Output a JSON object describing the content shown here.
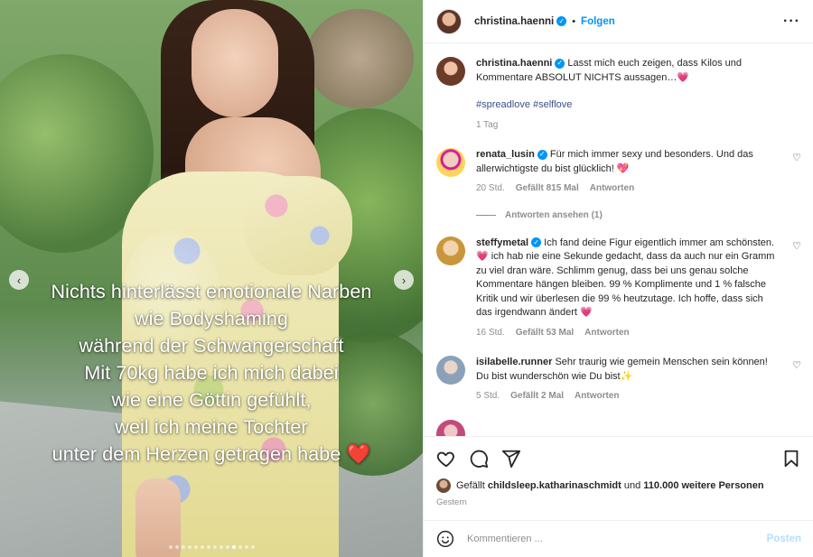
{
  "media": {
    "overlay_lines": [
      "Nichts hinterlässt emotionale Narben",
      "wie Bodyshaming",
      "während der Schwangerschaft",
      "Mit 70kg habe ich mich dabei",
      "wie eine Göttin gefühlt,",
      "weil ich meine Tochter",
      "unter dem Herzen getragen habe"
    ],
    "overlay_heart": "❤️",
    "prev_arrow": "‹",
    "next_arrow": "›",
    "dots_total": 14,
    "dots_active_index": 10
  },
  "header": {
    "username": "christina.haenni",
    "separator": "•",
    "follow_label": "Folgen",
    "more_icon": "···"
  },
  "caption": {
    "username": "christina.haenni",
    "text": "Lasst mich euch zeigen, dass Kilos und Kommentare ABSOLUT NICHTS aussagen…💗",
    "hashtags": "#spreadlove #selflove",
    "time": "1 Tag"
  },
  "comments": [
    {
      "username": "renata_lusin",
      "verified": true,
      "text": "Für mich immer sexy und besonders. Und das allerwichtigste du bist glücklich! 💖",
      "time": "20 Std.",
      "likes": "Gefällt 815 Mal",
      "reply": "Antworten"
    },
    {
      "username": "steffymetal",
      "verified": true,
      "text": "Ich fand deine Figur eigentlich immer am schönsten. 💗 ich hab nie eine Sekunde gedacht, dass da auch nur ein Gramm zu viel dran wäre. Schlimm genug, dass bei uns genau solche Kommentare hängen bleiben. 99 % Komplimente und 1 % falsche Kritik und wir überlesen die 99 % heutzutage. Ich hoffe, dass sich das irgendwann ändert 💗",
      "time": "16 Std.",
      "likes": "Gefällt 53 Mal",
      "reply": "Antworten"
    },
    {
      "username": "isilabelle.runner",
      "verified": false,
      "text": "Sehr traurig wie gemein Menschen sein können! Du bist wunderschön wie Du bist✨",
      "time": "5 Std.",
      "likes": "Gefällt 2 Mal",
      "reply": "Antworten"
    }
  ],
  "view_replies": "Antworten ansehen (1)",
  "actions": {
    "likes_prefix": "Gefällt",
    "likes_user": "childsleep.katharinaschmidt",
    "likes_middle": "und",
    "likes_count": "110.000 weitere Personen",
    "date": "Gestern"
  },
  "comment_box": {
    "placeholder": "Kommentieren ...",
    "post_label": "Posten"
  }
}
